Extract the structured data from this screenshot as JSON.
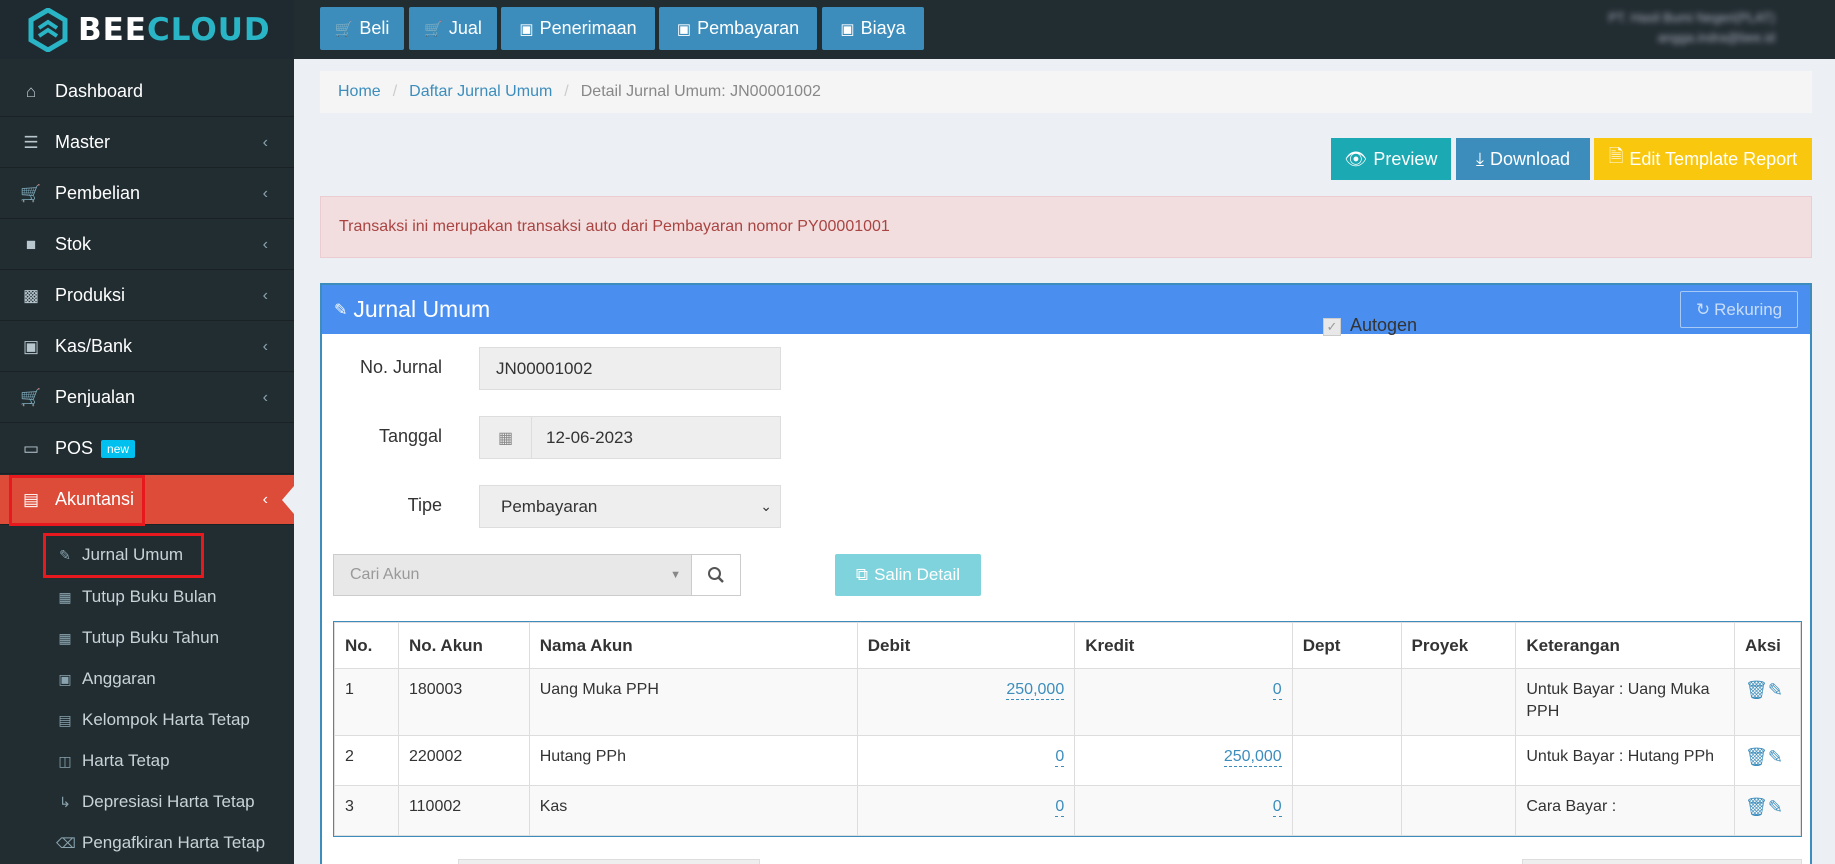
{
  "brand": {
    "part1": "BEE",
    "part2": "CLOUD"
  },
  "topnav": [
    {
      "label": "Beli",
      "icon": "cart-icon"
    },
    {
      "label": "Jual",
      "icon": "cart-icon"
    },
    {
      "label": "Penerimaan",
      "icon": "money-icon"
    },
    {
      "label": "Pembayaran",
      "icon": "money-icon"
    },
    {
      "label": "Biaya",
      "icon": "money-icon"
    }
  ],
  "user": {
    "company": "PT. Hasil Bumi Negeri(PLAT)",
    "email": "angga.indra@bee.id"
  },
  "sidebar": {
    "items": [
      {
        "label": "Dashboard"
      },
      {
        "label": "Master"
      },
      {
        "label": "Pembelian"
      },
      {
        "label": "Stok"
      },
      {
        "label": "Produksi"
      },
      {
        "label": "Kas/Bank"
      },
      {
        "label": "Penjualan"
      },
      {
        "label": "POS",
        "badge": "new"
      },
      {
        "label": "Akuntansi"
      }
    ],
    "subitems": [
      {
        "label": "Jurnal Umum"
      },
      {
        "label": "Tutup Buku Bulan"
      },
      {
        "label": "Tutup Buku Tahun"
      },
      {
        "label": "Anggaran"
      },
      {
        "label": "Kelompok Harta Tetap"
      },
      {
        "label": "Harta Tetap"
      },
      {
        "label": "Depresiasi Harta Tetap"
      },
      {
        "label": "Pengafkiran Harta Tetap"
      }
    ]
  },
  "breadcrumb": {
    "home": "Home",
    "list": "Daftar Jurnal Umum",
    "current": "Detail Jurnal Umum: JN00001002"
  },
  "actions": {
    "preview": "Preview",
    "download": "Download",
    "edit_template": "Edit Template Report"
  },
  "alert": "Transaksi ini merupakan transaksi auto dari Pembayaran nomor PY00001001",
  "panel": {
    "title": "Jurnal Umum",
    "rekuring": "Rekuring"
  },
  "form": {
    "no_jurnal_label": "No. Jurnal",
    "no_jurnal": "JN00001002",
    "tanggal_label": "Tanggal",
    "tanggal": "12-06-2023",
    "tipe_label": "Tipe",
    "tipe": "Pembayaran",
    "autogen_label": "Autogen",
    "autogen_checked": true,
    "cari_akun_placeholder": "Cari Akun",
    "salin_detail": "Salin Detail"
  },
  "table": {
    "headers": [
      "No.",
      "No. Akun",
      "Nama Akun",
      "Debit",
      "Kredit",
      "Dept",
      "Proyek",
      "Keterangan",
      "Aksi"
    ],
    "rows": [
      {
        "no": "1",
        "akun": "180003",
        "nama": "Uang Muka PPH",
        "debit": "250,000",
        "kredit": "0",
        "dept": "",
        "proyek": "",
        "ket": "Untuk Bayar : Uang Muka PPH"
      },
      {
        "no": "2",
        "akun": "220002",
        "nama": "Hutang PPh",
        "debit": "0",
        "kredit": "250,000",
        "dept": "",
        "proyek": "",
        "ket": "Untuk Bayar : Hutang PPh"
      },
      {
        "no": "3",
        "akun": "110002",
        "nama": "Kas",
        "debit": "0",
        "kredit": "0",
        "dept": "",
        "proyek": "",
        "ket": "Cara Bayar :"
      }
    ]
  }
}
